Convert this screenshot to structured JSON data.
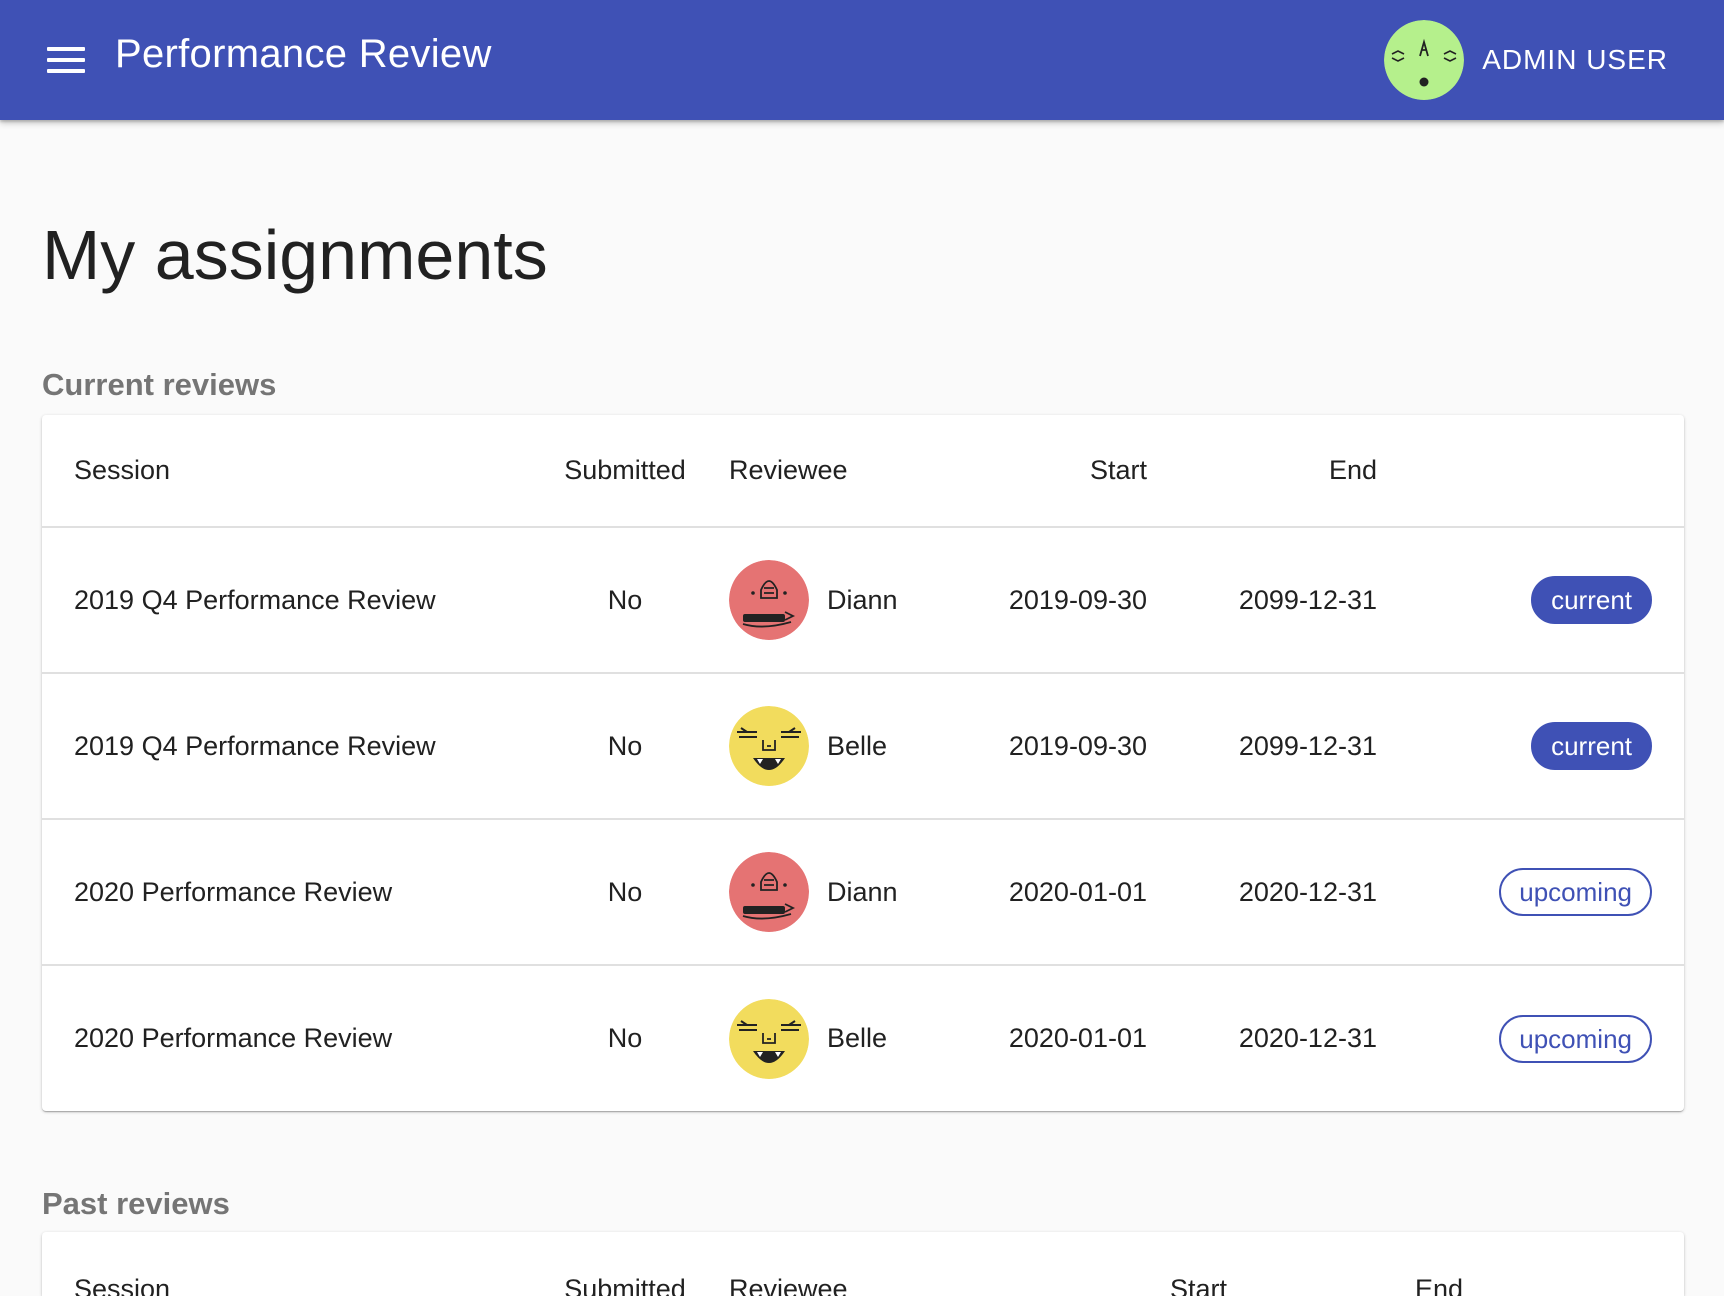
{
  "app": {
    "title": "Performance Review",
    "user_name": "ADMIN USER",
    "user_avatar_color": "#b5f08c"
  },
  "page": {
    "title": "My assignments"
  },
  "current": {
    "heading": "Current reviews",
    "columns": [
      "Session",
      "Submitted",
      "Reviewee",
      "Start",
      "End"
    ],
    "rows": [
      {
        "session": "2019 Q4 Performance Review",
        "submitted": "No",
        "reviewee": "Diann",
        "avatar_color": "#e57373",
        "start": "2019-09-30",
        "end": "2099-12-31",
        "status": "current"
      },
      {
        "session": "2019 Q4 Performance Review",
        "submitted": "No",
        "reviewee": "Belle",
        "avatar_color": "#f2dc5d",
        "start": "2019-09-30",
        "end": "2099-12-31",
        "status": "current"
      },
      {
        "session": "2020 Performance Review",
        "submitted": "No",
        "reviewee": "Diann",
        "avatar_color": "#e57373",
        "start": "2020-01-01",
        "end": "2020-12-31",
        "status": "upcoming"
      },
      {
        "session": "2020 Performance Review",
        "submitted": "No",
        "reviewee": "Belle",
        "avatar_color": "#f2dc5d",
        "start": "2020-01-01",
        "end": "2020-12-31",
        "status": "upcoming"
      }
    ]
  },
  "past": {
    "heading": "Past reviews",
    "columns": [
      "Session",
      "Submitted",
      "Reviewee",
      "Start",
      "End"
    ]
  },
  "colors": {
    "primary": "#3f51b5"
  }
}
